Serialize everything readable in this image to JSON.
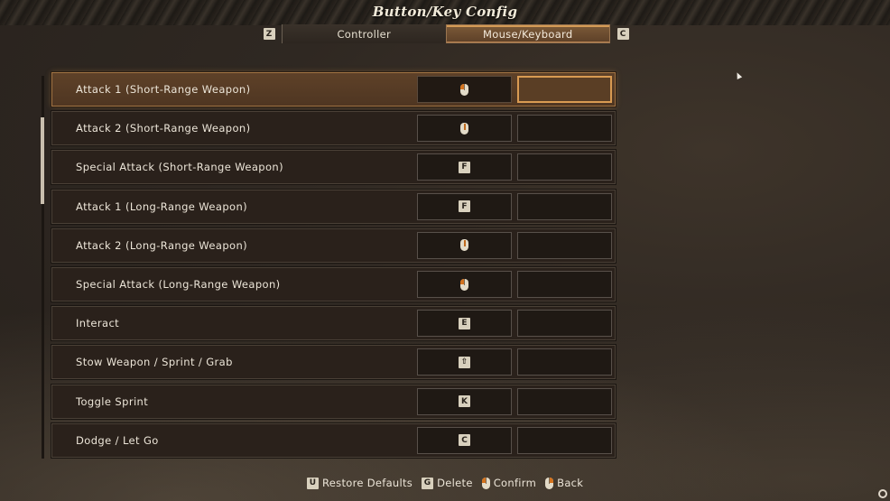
{
  "header": {
    "title": "Button/Key Config",
    "tab_prev_key": "Z",
    "tab_next_key": "C",
    "tabs": [
      {
        "label": "Controller",
        "active": false
      },
      {
        "label": "Mouse/Keyboard",
        "active": true
      }
    ]
  },
  "bindings": [
    {
      "action": "Attack 1 (Short-Range Weapon)",
      "primary": {
        "type": "mouse",
        "button": "left",
        "icon": "mouse-left-click-icon"
      },
      "secondary": "",
      "selected": true
    },
    {
      "action": "Attack 2 (Short-Range Weapon)",
      "primary": {
        "type": "mouse",
        "button": "middle",
        "icon": "mouse-middle-click-icon"
      },
      "secondary": "",
      "selected": false
    },
    {
      "action": "Special Attack (Short-Range Weapon)",
      "primary": {
        "type": "key",
        "key": "F"
      },
      "secondary": "",
      "selected": false
    },
    {
      "action": "Attack 1 (Long-Range Weapon)",
      "primary": {
        "type": "key",
        "key": "F"
      },
      "secondary": "",
      "selected": false
    },
    {
      "action": "Attack 2 (Long-Range Weapon)",
      "primary": {
        "type": "mouse",
        "button": "middle",
        "icon": "mouse-middle-click-icon"
      },
      "secondary": "",
      "selected": false
    },
    {
      "action": "Special Attack (Long-Range Weapon)",
      "primary": {
        "type": "mouse",
        "button": "left",
        "icon": "mouse-left-click-icon"
      },
      "secondary": "",
      "selected": false
    },
    {
      "action": "Interact",
      "primary": {
        "type": "key",
        "key": "E"
      },
      "secondary": "",
      "selected": false
    },
    {
      "action": "Stow Weapon / Sprint / Grab",
      "primary": {
        "type": "key",
        "key": "⇧"
      },
      "secondary": "",
      "selected": false
    },
    {
      "action": "Toggle Sprint",
      "primary": {
        "type": "key",
        "key": "K"
      },
      "secondary": "",
      "selected": false
    },
    {
      "action": "Dodge / Let Go",
      "primary": {
        "type": "key",
        "key": "C"
      },
      "secondary": "",
      "selected": false
    }
  ],
  "footer": {
    "restore_key": "U",
    "restore_label": "Restore Defaults",
    "delete_key": "G",
    "delete_label": "Delete",
    "confirm_label": "Confirm",
    "confirm_icon": "mouse-left-click-icon",
    "back_label": "Back",
    "back_icon": "mouse-right-click-icon"
  },
  "colors": {
    "accent": "#d99b52",
    "selected_row": "#5e4128",
    "row_bg": "#2a211b",
    "mouse_button": "#d4731e"
  }
}
